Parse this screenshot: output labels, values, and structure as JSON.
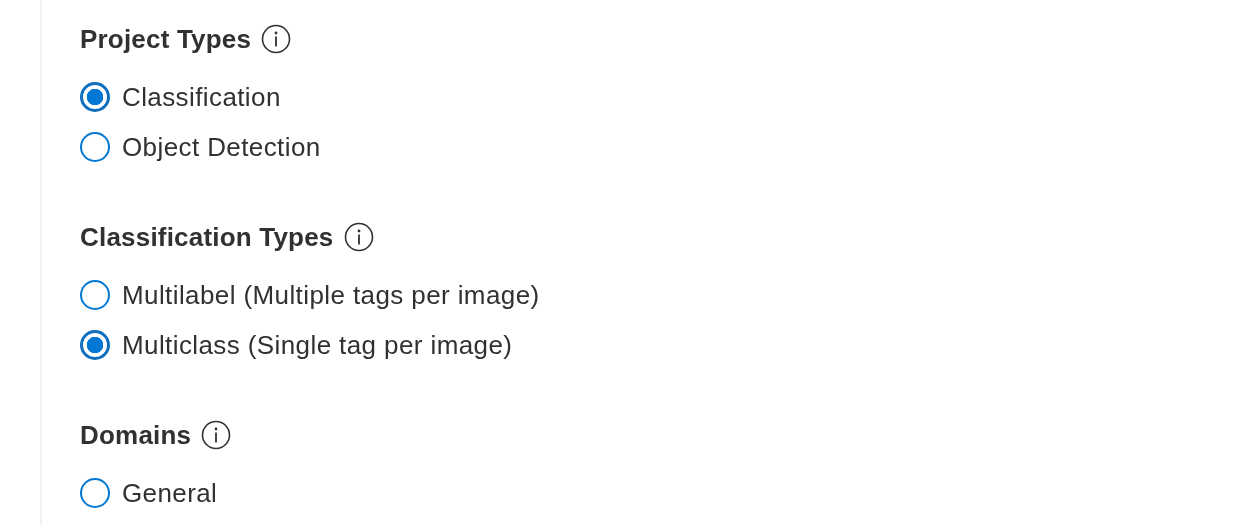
{
  "sections": [
    {
      "title": "Project Types",
      "options": [
        {
          "label": "Classification",
          "selected": true
        },
        {
          "label": "Object Detection",
          "selected": false
        }
      ]
    },
    {
      "title": "Classification Types",
      "options": [
        {
          "label": "Multilabel (Multiple tags per image)",
          "selected": false
        },
        {
          "label": "Multiclass (Single tag per image)",
          "selected": true
        }
      ]
    },
    {
      "title": "Domains",
      "options": [
        {
          "label": "General",
          "selected": false
        }
      ]
    }
  ]
}
